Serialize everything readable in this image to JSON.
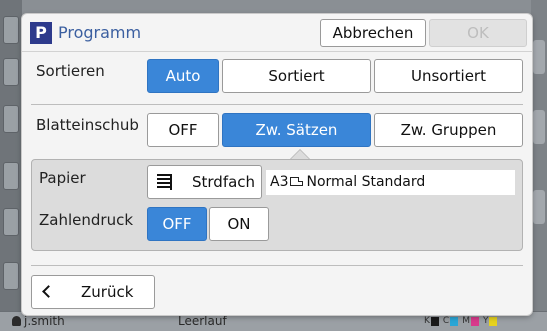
{
  "background": {
    "user": "j.smith",
    "status": "Leerlauf",
    "ink": [
      {
        "label": "K",
        "color": "#1a1a1a"
      },
      {
        "label": "C",
        "color": "#2aa6d6"
      },
      {
        "label": "M",
        "color": "#d93a8c"
      },
      {
        "label": "Y",
        "color": "#e6d21e"
      }
    ]
  },
  "dialog": {
    "icon_letter": "P",
    "title": "Programm",
    "cancel_label": "Abbrechen",
    "ok_label": "OK"
  },
  "sort": {
    "label": "Sortieren",
    "options": [
      "Auto",
      "Sortiert",
      "Unsortiert"
    ],
    "selected": "Auto"
  },
  "separator": {
    "label": "Blatteinschub",
    "options": [
      "OFF",
      "Zw. Sätzen",
      "Zw. Gruppen"
    ],
    "selected": "Zw. Sätzen"
  },
  "paper": {
    "label": "Papier",
    "tray_label": "Strdfach",
    "size": "A3",
    "type": "Normal Standard",
    "tray_icon": "paper-tray-icon",
    "orientation_icon": "portrait-orientation-icon"
  },
  "numbering": {
    "label": "Zahlendruck",
    "options": [
      "OFF",
      "ON"
    ],
    "selected": "OFF"
  },
  "footer": {
    "back_label": "Zurück"
  },
  "colors": {
    "accent": "#3a86d8",
    "title": "#3b5fa0",
    "icon_bg": "#2d3a8c"
  }
}
